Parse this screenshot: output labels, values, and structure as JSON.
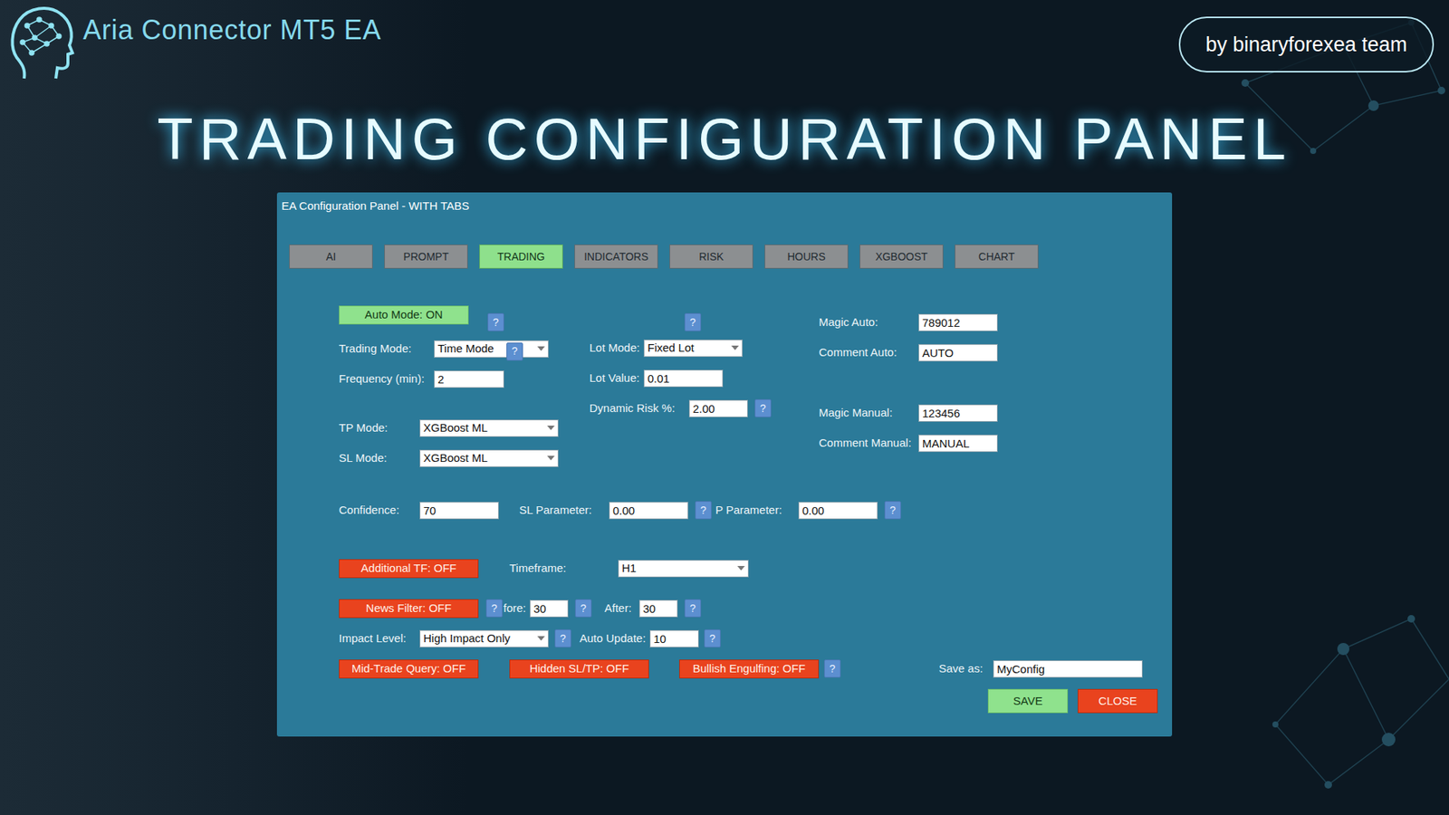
{
  "header": {
    "title": "Aria Connector MT5 EA",
    "badge": "by binaryforexea team",
    "heading": "TRADING CONFIGURATION PANEL"
  },
  "panel": {
    "title": "EA Configuration Panel - WITH TABS"
  },
  "tabs": [
    {
      "label": "AI",
      "selected": false
    },
    {
      "label": "PROMPT",
      "selected": false
    },
    {
      "label": "TRADING",
      "selected": true
    },
    {
      "label": "INDICATORS",
      "selected": false
    },
    {
      "label": "RISK",
      "selected": false
    },
    {
      "label": "HOURS",
      "selected": false
    },
    {
      "label": "XGBOOST",
      "selected": false
    },
    {
      "label": "CHART",
      "selected": false
    }
  ],
  "trading": {
    "auto_mode": {
      "label": "Auto Mode: ON",
      "on": true,
      "help": "?"
    },
    "trading_mode": {
      "label": "Trading Mode:",
      "value": "Time Mode",
      "help": "?"
    },
    "frequency": {
      "label": "Frequency (min):",
      "value": "2"
    },
    "tp_mode": {
      "label": "TP Mode:",
      "value": "XGBoost ML"
    },
    "sl_mode": {
      "label": "SL Mode:",
      "value": "XGBoost ML"
    },
    "lot_help": "?",
    "lot_mode": {
      "label": "Lot Mode:",
      "value": "Fixed Lot"
    },
    "lot_value": {
      "label": "Lot Value:",
      "value": "0.01"
    },
    "dynamic_risk": {
      "label": "Dynamic Risk %:",
      "value": "2.00",
      "help": "?"
    },
    "magic_auto": {
      "label": "Magic Auto:",
      "value": "789012"
    },
    "comment_auto": {
      "label": "Comment Auto:",
      "value": "AUTO"
    },
    "magic_manual": {
      "label": "Magic Manual:",
      "value": "123456"
    },
    "comment_manual": {
      "label": "Comment Manual:",
      "value": "MANUAL"
    },
    "confidence": {
      "label": "Confidence:",
      "value": "70"
    },
    "sl_parameter": {
      "label": "SL Parameter:",
      "value": "0.00",
      "help": "?"
    },
    "tp_parameter": {
      "label": "P Parameter:",
      "value": "0.00",
      "help": "?"
    },
    "additional_tf": {
      "label": "Additional TF: OFF",
      "on": false
    },
    "timeframe": {
      "label": "Timeframe:",
      "value": "H1"
    },
    "news_filter": {
      "label": "News Filter: OFF",
      "on": false,
      "help": "?"
    },
    "before": {
      "label": "fore:",
      "value": "30",
      "help": "?"
    },
    "after": {
      "label": "After:",
      "value": "30",
      "help": "?"
    },
    "impact_level": {
      "label": "Impact Level:",
      "value": "High Impact Only",
      "help": "?"
    },
    "auto_update": {
      "label": "Auto Update:",
      "value": "10",
      "help": "?"
    },
    "mid_trade_query": {
      "label": "Mid-Trade Query: OFF",
      "on": false
    },
    "hidden_sl_tp": {
      "label": "Hidden SL/TP: OFF",
      "on": false
    },
    "bullish_engulfing": {
      "label": "Bullish Engulfing: OFF",
      "on": false,
      "help": "?"
    },
    "save_as": {
      "label": "Save as:",
      "value": "MyConfig"
    }
  },
  "buttons": [
    {
      "label": "SAVE"
    },
    {
      "label": "CLOSE"
    }
  ]
}
